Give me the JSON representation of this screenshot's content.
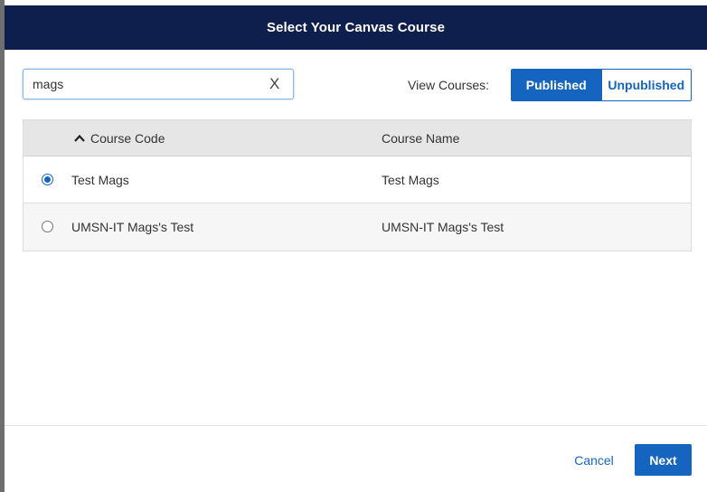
{
  "modal": {
    "title": "Select Your Canvas Course"
  },
  "search": {
    "value": "mags",
    "clear_label": "X"
  },
  "view_courses": {
    "label": "View Courses:",
    "options": [
      "Published",
      "Unpublished"
    ],
    "selected": "Published"
  },
  "table": {
    "columns": [
      "Course Code",
      "Course Name"
    ],
    "sort": {
      "column": "Course Code",
      "direction": "ascending"
    },
    "rows": [
      {
        "code": "Test Mags",
        "name": "Test Mags",
        "selected": true
      },
      {
        "code": "UMSN-IT Mags's Test",
        "name": "UMSN-IT Mags's Test",
        "selected": false
      }
    ]
  },
  "footer": {
    "cancel_label": "Cancel",
    "next_label": "Next"
  },
  "colors": {
    "header_bg": "#0f1f4d",
    "accent": "#1565c0"
  }
}
